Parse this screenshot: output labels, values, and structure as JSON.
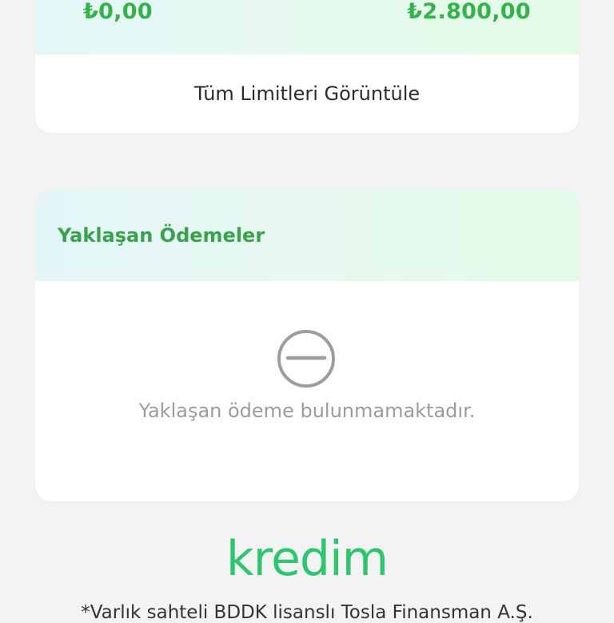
{
  "limits": {
    "amount_left": "₺0,00",
    "amount_right": "₺2.800,00",
    "view_all_label": "Tüm Limitleri Görüntüle"
  },
  "payments": {
    "title": "Yaklaşan Ödemeler",
    "empty_icon": "minus-circle-icon",
    "empty_text": "Yaklaşan ödeme bulunmamaktadır."
  },
  "brand": {
    "logo_text": "kredim",
    "footer_text": "*Varlık sahteli BDDK lisanslı Tosla Finansman A.Ş.",
    "accent_color": "#36b24b",
    "logo_color": "#2ec56f"
  }
}
